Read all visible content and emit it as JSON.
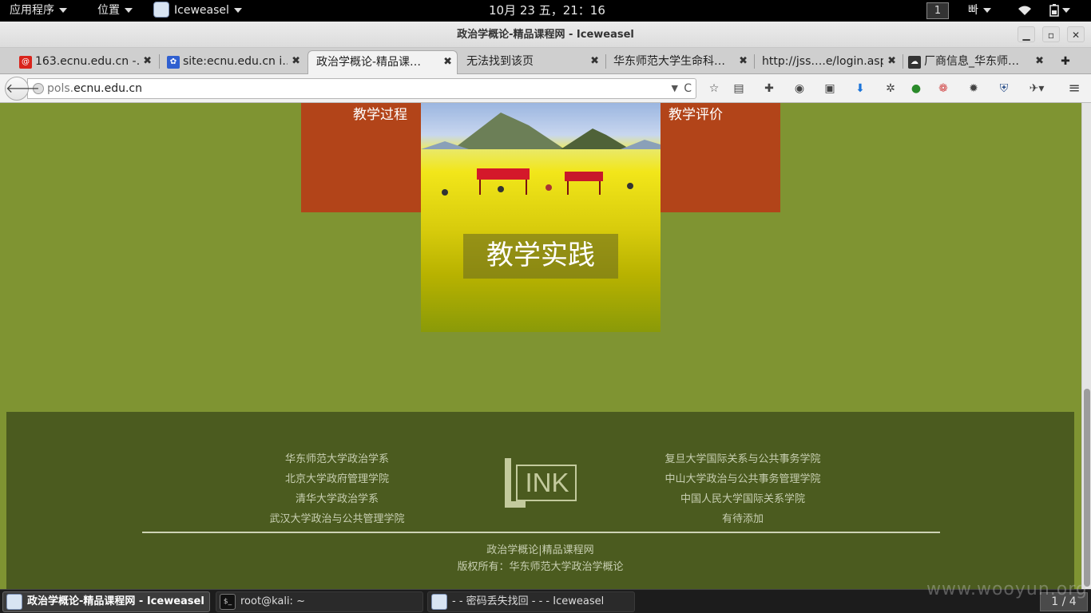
{
  "topbar": {
    "apps_menu": "应用程序",
    "places_menu": "位置",
    "app_name": "Iceweasel",
    "clock": "10月 23 五，21：16",
    "workspace": "1",
    "input_method": "빠"
  },
  "window": {
    "title": "政治学概论-精品课程网 - Iceweasel",
    "minimize": "▁",
    "maximize": "▫",
    "close": "✕"
  },
  "tabs": [
    {
      "label": "163.ecnu.edu.cn -…",
      "close": "✖",
      "icon": "mail-icon"
    },
    {
      "label": "site:ecnu.edu.cn i…",
      "close": "✖",
      "icon": "paw-icon"
    },
    {
      "label": "政治学概论-精品课…",
      "close": "✖",
      "active": true
    },
    {
      "label": "无法找到该页",
      "close": "✖"
    },
    {
      "label": "华东师范大学生命科…",
      "close": "✖"
    },
    {
      "label": "http://jss….e/login.asp",
      "close": "✖"
    },
    {
      "label": "厂商信息_华东师…",
      "close": "✖",
      "icon": "vendor-icon"
    }
  ],
  "new_tab": "✚",
  "navbar": {
    "url_prefix": "pols.",
    "url_domain": "ecnu.edu.cn",
    "back": "🡐",
    "dropdown": "▼",
    "reload": "C"
  },
  "page": {
    "left_block_label": "教学过程",
    "right_block_label": "教学评价",
    "practice_label": "教学实践",
    "footer": {
      "left_links": [
        "华东师范大学政治学系",
        "北京大学政府管理学院",
        "清华大学政治学系",
        "武汉大学政治与公共管理学院"
      ],
      "right_links": [
        "复旦大学国际关系与公共事务学院",
        "中山大学政治与公共事务管理学院",
        "中国人民大学国际关系学院",
        "有待添加"
      ],
      "logo_text": "INK",
      "logo_l": "L",
      "site_line": "政治学概论|精品课程网",
      "copyright": "版权所有：华东师范大学政治学概论"
    }
  },
  "taskbar": {
    "tasks": [
      {
        "label": "政治学概论-精品课程网 - Iceweasel",
        "active": true
      },
      {
        "label": "root@kali: ~"
      },
      {
        "label": "- - 密码丢失找回 - - - Iceweasel"
      }
    ],
    "pager": "1 / 4"
  },
  "watermark": "www.wooyun.org",
  "colors": {
    "page_bg": "#7f9432",
    "block": "#b24419",
    "footer_bg": "#4b5b1f"
  }
}
